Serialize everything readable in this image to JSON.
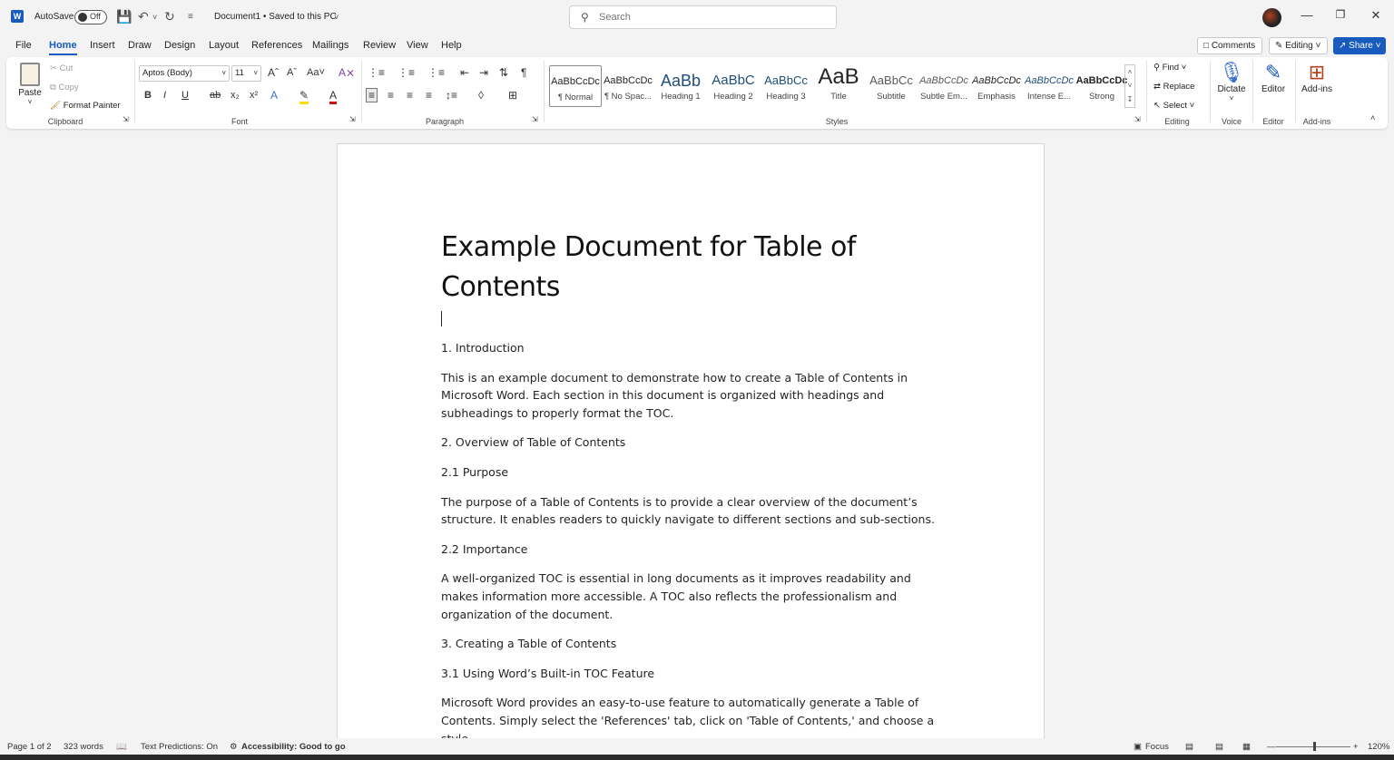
{
  "titlebar": {
    "autosave_label": "AutoSave",
    "autosave_state": "Off",
    "doc_title": "Document1 • Saved to this PC",
    "search_placeholder": "Search"
  },
  "menu": {
    "tabs": [
      "File",
      "Home",
      "Insert",
      "Draw",
      "Design",
      "Layout",
      "References",
      "Mailings",
      "Review",
      "View",
      "Help"
    ],
    "active": "Home",
    "comments_label": "Comments",
    "editing_label": "Editing",
    "share_label": "Share"
  },
  "ribbon": {
    "clipboard": {
      "paste": "Paste",
      "cut": "Cut",
      "copy": "Copy",
      "format_painter": "Format Painter",
      "label": "Clipboard"
    },
    "font": {
      "family": "Aptos (Body)",
      "size": "11",
      "label": "Font"
    },
    "paragraph": {
      "label": "Paragraph"
    },
    "styles": {
      "label": "Styles",
      "items": [
        {
          "preview": "AaBbCcDc",
          "name": "¶ Normal"
        },
        {
          "preview": "AaBbCcDc",
          "name": "¶ No Spac..."
        },
        {
          "preview": "AaBb",
          "name": "Heading 1"
        },
        {
          "preview": "AaBbC",
          "name": "Heading 2"
        },
        {
          "preview": "AaBbCc",
          "name": "Heading 3"
        },
        {
          "preview": "AaB",
          "name": "Title"
        },
        {
          "preview": "AaBbCc",
          "name": "Subtitle"
        },
        {
          "preview": "AaBbCcDc",
          "name": "Subtle Em..."
        },
        {
          "preview": "AaBbCcDc",
          "name": "Emphasis"
        },
        {
          "preview": "AaBbCcDc",
          "name": "Intense E..."
        },
        {
          "preview": "AaBbCcDc",
          "name": "Strong"
        }
      ]
    },
    "editing": {
      "find": "Find",
      "replace": "Replace",
      "select": "Select",
      "label": "Editing"
    },
    "voice": {
      "dictate": "Dictate",
      "label": "Voice"
    },
    "editor": {
      "editor": "Editor",
      "label": "Editor"
    },
    "addins": {
      "addins": "Add-ins",
      "label": "Add-ins"
    }
  },
  "document": {
    "title": "Example Document for Table of Contents",
    "blocks": [
      {
        "type": "h",
        "text": "1. Introduction"
      },
      {
        "type": "p",
        "text": "This is an example document to demonstrate how to create a Table of Contents in Microsoft Word. Each section in this document is organized with headings and subheadings to properly format the TOC."
      },
      {
        "type": "h",
        "text": "2. Overview of Table of Contents"
      },
      {
        "type": "h",
        "text": "2.1 Purpose"
      },
      {
        "type": "p",
        "text": "The purpose of a Table of Contents is to provide a clear overview of the document’s structure. It enables readers to quickly navigate to different sections and sub-sections."
      },
      {
        "type": "h",
        "text": "2.2 Importance"
      },
      {
        "type": "p",
        "text": "A well-organized TOC is essential in long documents as it improves readability and makes information more accessible. A TOC also reflects the professionalism and organization of the document."
      },
      {
        "type": "h",
        "text": "3. Creating a Table of Contents"
      },
      {
        "type": "h",
        "text": "3.1 Using Word’s Built-in TOC Feature"
      },
      {
        "type": "p",
        "text": "Microsoft Word provides an easy-to-use feature to automatically generate a Table of Contents. Simply select the 'References' tab, click on 'Table of Contents,' and choose a style..."
      }
    ]
  },
  "statusbar": {
    "page": "Page 1 of 2",
    "words": "323 words",
    "predictions": "Text Predictions: On",
    "accessibility": "Accessibility: Good to go",
    "focus": "Focus",
    "zoom": "120%"
  }
}
